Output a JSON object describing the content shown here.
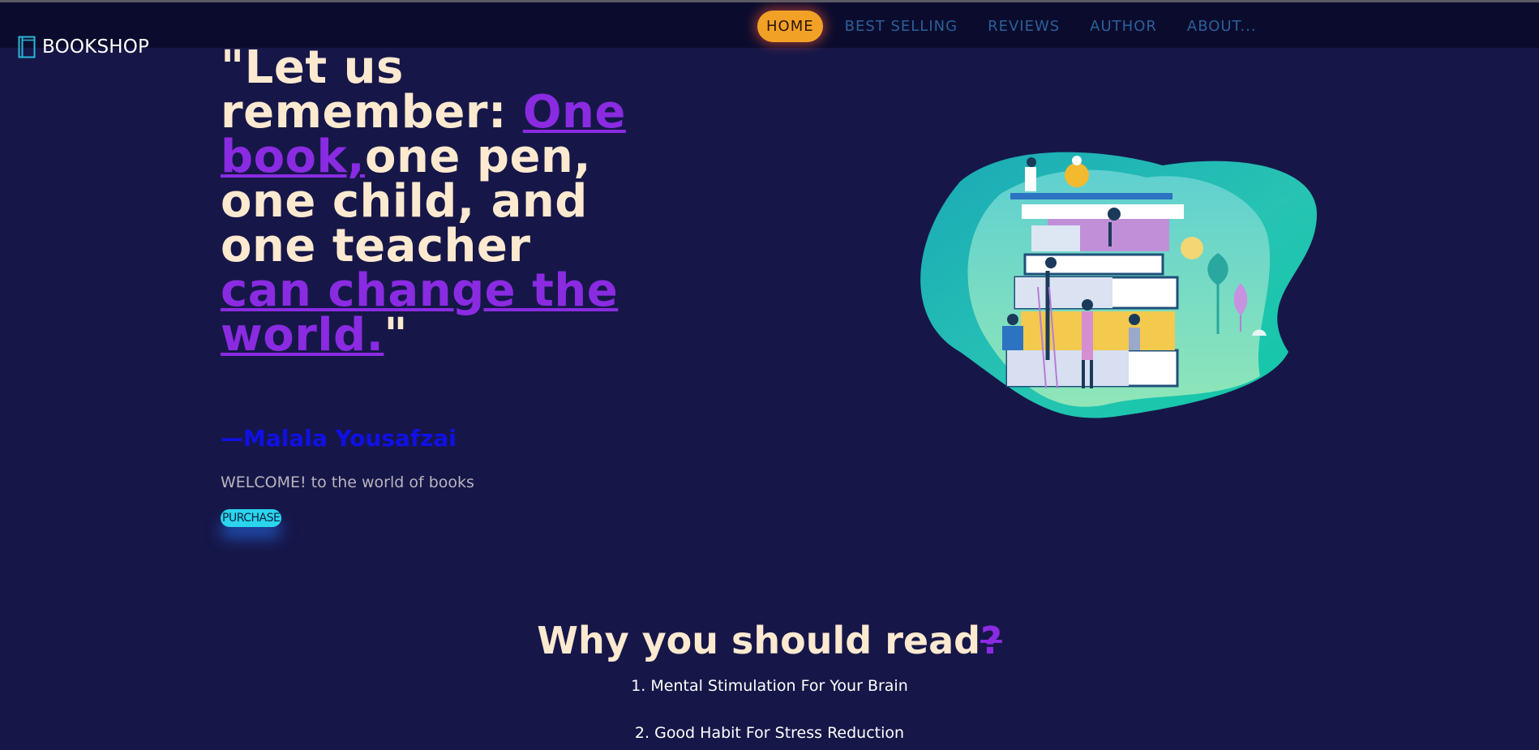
{
  "brand": {
    "name": "BOOKSHOP",
    "icon": "book-icon"
  },
  "nav": {
    "items": [
      {
        "label": "HOME",
        "active": true
      },
      {
        "label": "BEST SELLING",
        "active": false
      },
      {
        "label": "REVIEWS",
        "active": false
      },
      {
        "label": "AUTHOR",
        "active": false
      },
      {
        "label": "ABOUT...",
        "active": false
      }
    ]
  },
  "hero": {
    "quote_open": "\"Let us remember: ",
    "quote_accent_1": "One book,",
    "quote_mid": "one pen, one child, and one teacher ",
    "quote_accent_2": "can change the world.",
    "quote_close": "\"",
    "author": "—Malala Yousafzai",
    "welcome": "WELCOME! to the world of books",
    "cta": "PURCHASE",
    "illustration": "people-on-book-stack-illustration"
  },
  "section": {
    "title": "Why you should read",
    "title_mark": "?",
    "reasons": [
      "1. Mental Stimulation For Your Brain",
      "2. Good Habit For Stress Reduction"
    ]
  },
  "colors": {
    "background": "#161748",
    "navbar": "#0b0c2d",
    "accent_purple": "#8a2be2",
    "active_nav": "#f2a127",
    "cta": "#2bd5ec",
    "author": "#1010e6"
  }
}
